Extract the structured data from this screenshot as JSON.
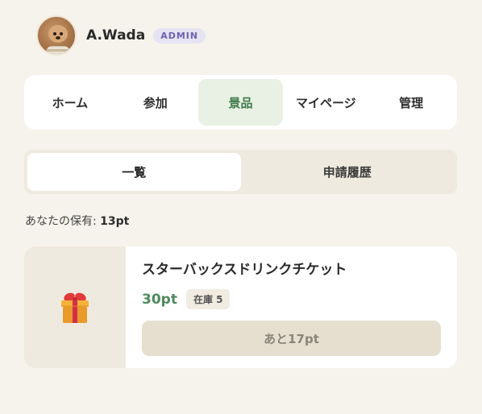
{
  "user": {
    "name": "A.Wada",
    "role_badge": "ADMIN"
  },
  "nav": {
    "items": [
      {
        "label": "ホーム"
      },
      {
        "label": "参加"
      },
      {
        "label": "景品"
      },
      {
        "label": "マイページ"
      },
      {
        "label": "管理"
      }
    ],
    "active_index": 2
  },
  "subtabs": {
    "items": [
      {
        "label": "一覧"
      },
      {
        "label": "申請履歴"
      }
    ],
    "active_index": 0
  },
  "balance": {
    "label": "あなたの保有: ",
    "value": "13pt"
  },
  "rewards": [
    {
      "icon": "gift-icon",
      "title": "スターバックスドリンクチケット",
      "cost": "30pt",
      "stock": "在庫 5",
      "button_label": "あと17pt"
    }
  ],
  "colors": {
    "background": "#f6f3ec",
    "accent_green": "#4e8a5c",
    "active_tab_bg": "#e8f1e4",
    "badge_bg": "#e6e3f3",
    "badge_text": "#6e62b0"
  }
}
